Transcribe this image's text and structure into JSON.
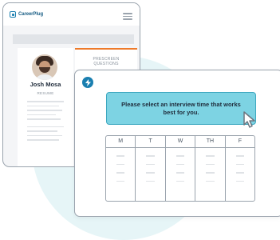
{
  "brand": {
    "logo_text": "CareerPlug",
    "logo_icon": "careerplug-logo-icon",
    "menu_icon": "hamburger-menu-icon"
  },
  "profile": {
    "name": "Josh Mosa",
    "subtitle": "RESUME"
  },
  "prescreen": {
    "title": "PRESCREEN QUESTIONS"
  },
  "scheduler": {
    "icon": "lightning-bolt-icon",
    "prompt": "Please select an interview time that works best for you.",
    "cursor_icon": "mouse-pointer-icon",
    "days": [
      "M",
      "T",
      "W",
      "TH",
      "F"
    ]
  },
  "colors": {
    "accent_teal": "#7dd3e3",
    "brand_blue": "#1a7fb0",
    "prescreen_orange": "#ee7a2a",
    "outline_gray": "#9aa3ad"
  }
}
